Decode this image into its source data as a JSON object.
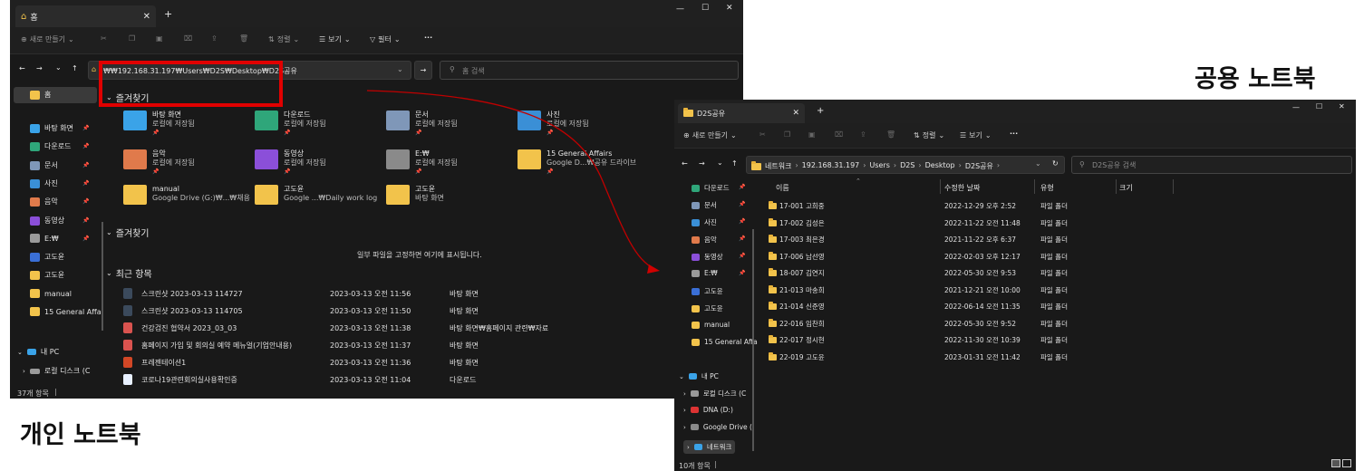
{
  "labels": {
    "personal": "개인 노트북",
    "shared": "공용 노트북"
  },
  "left": {
    "tab_title": "홈",
    "toolbar": {
      "new": "새로 만들기",
      "sort": "정렬",
      "view": "보기",
      "filter": "필터",
      "more": "···"
    },
    "address": "₩₩192.168.31.197₩Users₩D2S₩Desktop₩D2S공유",
    "search_placeholder": "홈 검색",
    "sidebar": [
      {
        "label": "홈",
        "icon": "home-icon"
      },
      {
        "label": "바탕 화면",
        "icon": "desktop-icon",
        "pinned": true
      },
      {
        "label": "다운로드",
        "icon": "download-icon",
        "pinned": true
      },
      {
        "label": "문서",
        "icon": "document-icon",
        "pinned": true
      },
      {
        "label": "사진",
        "icon": "picture-icon",
        "pinned": true
      },
      {
        "label": "음악",
        "icon": "music-icon",
        "pinned": true
      },
      {
        "label": "동영상",
        "icon": "video-icon",
        "pinned": true
      },
      {
        "label": "E:₩",
        "icon": "drive-icon",
        "pinned": true
      },
      {
        "label": "고도윤",
        "icon": "user-folder-icon"
      },
      {
        "label": "고도윤",
        "icon": "folder-icon"
      },
      {
        "label": "manual",
        "icon": "folder-icon"
      },
      {
        "label": "15 General Affa",
        "icon": "shared-folder-icon"
      }
    ],
    "sidebar_pc": {
      "label": "내 PC",
      "drive": "로컬 디스크 (C"
    },
    "section1": "즐겨찾기",
    "quick": [
      {
        "name": "바탕 화면",
        "sub": "로컬에 저장됨",
        "color": "#3aa3e8"
      },
      {
        "name": "다운로드",
        "sub": "로컬에 저장됨",
        "color": "#2fa67a"
      },
      {
        "name": "문서",
        "sub": "로컬에 저장됨",
        "color": "#7f97b8"
      },
      {
        "name": "사진",
        "sub": "로컬에 저장됨",
        "color": "#3a8fd6"
      },
      {
        "name": "음악",
        "sub": "로컬에 저장됨",
        "color": "#e07a4b"
      },
      {
        "name": "동영상",
        "sub": "로컬에 저장됨",
        "color": "#8b4fd9"
      },
      {
        "name": "E:₩",
        "sub": "로컬에 저장됨",
        "color": "#8a8a8a"
      },
      {
        "name": "15 General Affairs",
        "sub": "Google D...₩공유 드라이브",
        "color": "#f2c34b"
      },
      {
        "name": "manual",
        "sub": "Google Drive (G:)₩...₩채용",
        "color": "#f2c34b"
      },
      {
        "name": "고도윤",
        "sub": "Google ...₩Daily work log",
        "color": "#f2c34b"
      },
      {
        "name": "고도윤",
        "sub": "바탕 화면",
        "color": "#f2c34b"
      }
    ],
    "section2": "즐겨찾기",
    "pin_hint": "일부 파일을 고정하면 여기에 표시됩니다.",
    "section3": "최근 항목",
    "recent": [
      {
        "name": "스크린샷 2023-03-13 114727",
        "date": "2023-03-13 오전 11:56",
        "loc": "바탕 화면",
        "icon": "screenshot-icon"
      },
      {
        "name": "스크린샷 2023-03-13 114705",
        "date": "2023-03-13 오전 11:50",
        "loc": "바탕 화면",
        "icon": "screenshot-icon"
      },
      {
        "name": "건강검진 협약서 2023_03_03",
        "date": "2023-03-13 오전 11:38",
        "loc": "바탕 화면₩홈페이지 관련₩자료",
        "icon": "pdf-icon"
      },
      {
        "name": "홈페이지 가입 및 회의실 예약 메뉴얼(기업안내용)",
        "date": "2023-03-13 오전 11:37",
        "loc": "바탕 화면",
        "icon": "pdf-icon"
      },
      {
        "name": "프레젠테이션1",
        "date": "2023-03-13 오전 11:36",
        "loc": "바탕 화면",
        "icon": "ppt-icon"
      },
      {
        "name": "코로나19관련회의실사용확인증",
        "date": "2023-03-13 오전 11:04",
        "loc": "다운로드",
        "icon": "word-icon"
      }
    ],
    "status": "37개 항목"
  },
  "right": {
    "tab_title": "D2S공유",
    "toolbar": {
      "new": "새로 만들기",
      "sort": "정렬",
      "view": "보기",
      "more": "···"
    },
    "crumbs": [
      "네트워크",
      "192.168.31.197",
      "Users",
      "D2S",
      "Desktop",
      "D2S공유"
    ],
    "search_placeholder": "D2S공유 검색",
    "columns": {
      "name": "이름",
      "date": "수정한 날짜",
      "type": "유형",
      "size": "크기"
    },
    "files": [
      {
        "name": "17-001 고희중",
        "date": "2022-12-29 오후 2:52",
        "type": "파일 폴더"
      },
      {
        "name": "17-002 김성은",
        "date": "2022-11-22 오전 11:48",
        "type": "파일 폴더"
      },
      {
        "name": "17-003 최은경",
        "date": "2021-11-22 오후 6:37",
        "type": "파일 폴더"
      },
      {
        "name": "17-006 남선영",
        "date": "2022-02-03 오후 12:17",
        "type": "파일 폴더"
      },
      {
        "name": "18-007 김연지",
        "date": "2022-05-30 오전 9:53",
        "type": "파일 폴더"
      },
      {
        "name": "21-013 마송희",
        "date": "2021-12-21 오전 10:00",
        "type": "파일 폴더"
      },
      {
        "name": "21-014 신준영",
        "date": "2022-06-14 오전 11:35",
        "type": "파일 폴더"
      },
      {
        "name": "22-016 임찬희",
        "date": "2022-05-30 오전 9:52",
        "type": "파일 폴더"
      },
      {
        "name": "22-017 정시현",
        "date": "2022-11-30 오전 10:39",
        "type": "파일 폴더"
      },
      {
        "name": "22-019 고도윤",
        "date": "2023-01-31 오전 11:42",
        "type": "파일 폴더"
      }
    ],
    "sidebar": [
      {
        "label": "다운로드",
        "icon": "download-icon",
        "pinned": true
      },
      {
        "label": "문서",
        "icon": "document-icon",
        "pinned": true
      },
      {
        "label": "사진",
        "icon": "picture-icon",
        "pinned": true
      },
      {
        "label": "음악",
        "icon": "music-icon",
        "pinned": true
      },
      {
        "label": "동영상",
        "icon": "video-icon",
        "pinned": true
      },
      {
        "label": "E:₩",
        "icon": "drive-icon",
        "pinned": true
      },
      {
        "label": "고도윤",
        "icon": "user-folder-icon"
      },
      {
        "label": "고도윤",
        "icon": "folder-icon"
      },
      {
        "label": "manual",
        "icon": "folder-icon"
      },
      {
        "label": "15 General Affa",
        "icon": "shared-folder-icon"
      }
    ],
    "sidebar_tree": [
      {
        "label": "내 PC",
        "icon": "pc-icon"
      },
      {
        "label": "로컬 디스크 (C",
        "icon": "disk-icon"
      },
      {
        "label": "DNA (D:)",
        "icon": "usb-icon"
      },
      {
        "label": "Google Drive (",
        "icon": "gdrive-icon"
      },
      {
        "label": "네트워크",
        "icon": "network-icon"
      }
    ],
    "status": "10개 항목"
  },
  "colors": {
    "bg": "#191919",
    "accent": "#3aa3e8",
    "highlight": "#e00000",
    "folder": "#f2c34b"
  }
}
